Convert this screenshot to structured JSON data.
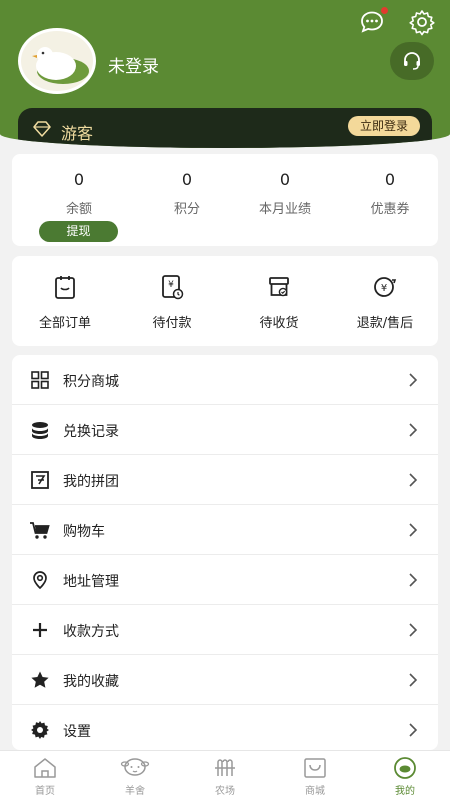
{
  "header": {
    "login_status": "未登录",
    "vip_label": "游客",
    "login_button": "立即登录"
  },
  "stats": [
    {
      "value": "0",
      "label": "余额"
    },
    {
      "value": "0",
      "label": "积分"
    },
    {
      "value": "0",
      "label": "本月业绩"
    },
    {
      "value": "0",
      "label": "优惠券"
    }
  ],
  "withdraw_label": "提现",
  "orders": [
    {
      "label": "全部订单",
      "icon": "clipboard-icon"
    },
    {
      "label": "待付款",
      "icon": "payment-icon"
    },
    {
      "label": "待收货",
      "icon": "delivery-box-icon"
    },
    {
      "label": "退款/售后",
      "icon": "refund-icon"
    }
  ],
  "menu": [
    {
      "label": "积分商城",
      "icon": "grid-icon"
    },
    {
      "label": "兑换记录",
      "icon": "coin-stack-icon"
    },
    {
      "label": "我的拼团",
      "icon": "group-buy-icon"
    },
    {
      "label": "购物车",
      "icon": "cart-icon"
    },
    {
      "label": "地址管理",
      "icon": "location-icon"
    },
    {
      "label": "收款方式",
      "icon": "plus-icon"
    },
    {
      "label": "我的收藏",
      "icon": "star-icon"
    },
    {
      "label": "设置",
      "icon": "gear-icon"
    }
  ],
  "tabs": [
    {
      "label": "首页",
      "icon": "home-icon"
    },
    {
      "label": "羊舍",
      "icon": "sheep-icon"
    },
    {
      "label": "农场",
      "icon": "farm-icon"
    },
    {
      "label": "商城",
      "icon": "shop-bag-icon"
    },
    {
      "label": "我的",
      "icon": "profile-icon",
      "active": true
    }
  ],
  "colors": {
    "brand_green": "#5b8a33",
    "badge_red": "#e23b2e",
    "vip_gold": "#f3d99a"
  }
}
